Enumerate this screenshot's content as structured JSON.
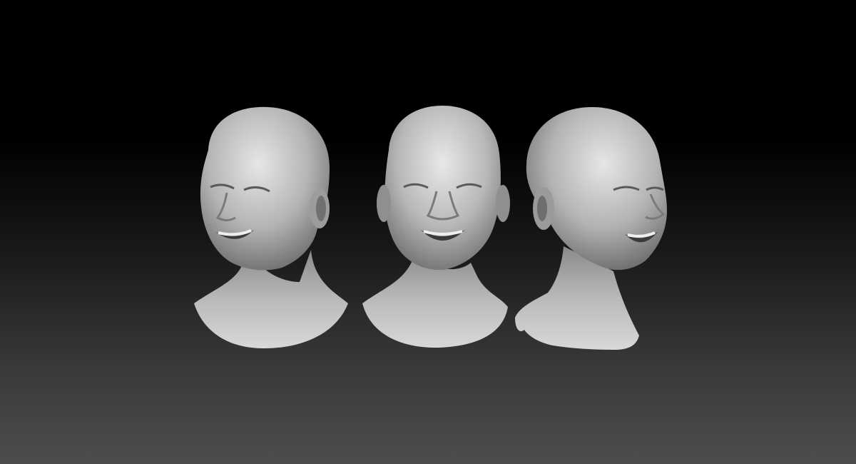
{
  "scene": {
    "background_top": "#000000",
    "background_bottom": "#4d4d4d",
    "material_color": "#bdbdbd",
    "busts": [
      {
        "view": "three-quarter-left"
      },
      {
        "view": "front"
      },
      {
        "view": "three-quarter-right"
      }
    ]
  }
}
